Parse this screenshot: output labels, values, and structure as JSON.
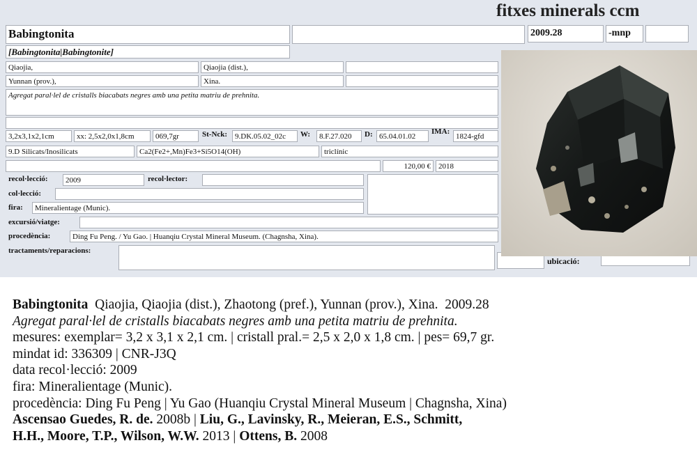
{
  "header": {
    "title": "fitxes minerals ccm"
  },
  "card": {
    "name": "Babingtonita",
    "code": "2009.28",
    "suffix": "-mnp",
    "synonyms": "[Babingtonita|Babingtonite]",
    "locality": "Qiaojia,",
    "district": "Qiaojia (dist.),",
    "province": "Yunnan (prov.),",
    "country": "Xina.",
    "description": "Agregat paral·lel de cristalls biacabats negres amb una petita matriu de prehnita.",
    "dimensions": "3,2x3,1x2,1cm",
    "crystal": "xx: 2,5x2,0x1,8cm",
    "weight": "069,7gr",
    "stnck_label": "St-Nck:",
    "stnck": "9.DK.05.02_02c",
    "w_label": "W:",
    "w": "8.F.27.020",
    "d_label": "D:",
    "d": "65.04.01.02",
    "ima_label": "IMA:",
    "ima": "1824-gfd",
    "class": "9.D Silicats/Inosilicats",
    "formula": "Ca2(Fe2+,Mn)Fe3+Si5O14(OH)",
    "system": "triclínic",
    "price": "120,00 €",
    "price_year": "2018",
    "recol_label": "recol·lecció:",
    "recol": "2009",
    "recollector_label": "recol·lector:",
    "colleccio_label": "col·lecció:",
    "fira_label": "fira:",
    "fira": "Mineralientage (Munic).",
    "excursio_label": "excursió/viatge:",
    "procedencia_label": "procedència:",
    "procedencia": "Ding Fu Peng. / Yu Gao. | Huanqiu Crystal Mineral Museum. (Chagnsha, Xina).",
    "tractaments_label": "tractaments/reparacions:",
    "ubicacio_label": "ubicació:"
  },
  "summary": {
    "name": "Babingtonita",
    "locality": "Qiaojia, Qiaojia (dist.), Zhaotong (pref.), Yunnan (prov.), Xina.",
    "code": "2009.28",
    "description": "Agregat paral·lel de cristalls biacabats negres amb una petita matriu de prehnita.",
    "mesures": "mesures: exemplar= 3,2 x 3,1 x 2,1 cm. | cristall pral.= 2,5 x 2,0 x 1,8 cm. | pes= 69,7 gr.",
    "mindat": "mindat id: 336309 | CNR-J3Q",
    "data_recol": "data recol·lecció: 2009",
    "fira": "fira: Mineralientage (Munic).",
    "procedencia": "procedència: Ding Fu Peng | Yu Gao (Huanqiu Crystal Mineral Museum | Chagnsha, Xina)",
    "ref1_author": "Ascensao Guedes, R. de.",
    "ref1_rest": " 2008b | ",
    "ref2_author_a": "Liu, G., Lavinsky, R., Meieran, E.S., Schmitt,",
    "ref2_author_b": "H.H., Moore, T.P., Wilson, W.W.",
    "ref2_rest": " 2013 | ",
    "ref3_author": "Ottens, B.",
    "ref3_rest": " 2008"
  }
}
